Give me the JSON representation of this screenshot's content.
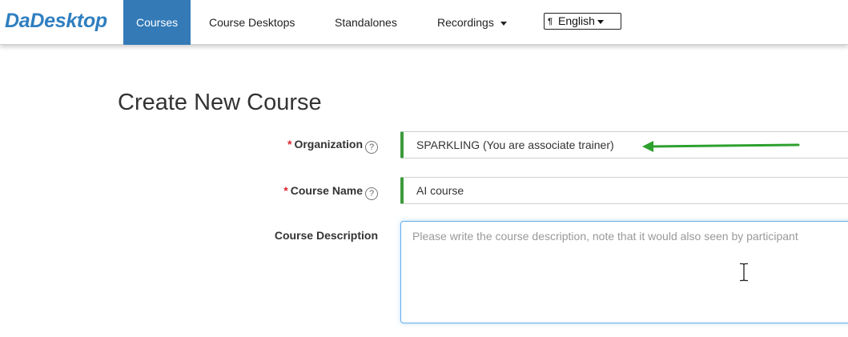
{
  "app": {
    "brand": "DaDesktop"
  },
  "nav": {
    "items": [
      {
        "label": "Courses",
        "active": true
      },
      {
        "label": "Course Desktops"
      },
      {
        "label": "Standalones"
      },
      {
        "label": "Recordings",
        "dropdown": true
      }
    ],
    "language": {
      "label": "English",
      "icon": "language-flag-icon"
    }
  },
  "page": {
    "title": "Create New Course"
  },
  "form": {
    "organization": {
      "label": "Organization",
      "required": true,
      "value": "SPARKLING (You are associate trainer)"
    },
    "course_name": {
      "label": "Course Name",
      "required": true,
      "value": "AI course"
    },
    "course_description": {
      "label": "Course Description",
      "value": "",
      "placeholder": "Please write the course description, note that it would also seen by participant"
    },
    "help_glyph": "?",
    "required_marker": "*"
  },
  "colors": {
    "brand": "#2f7fc0",
    "active_nav": "#337ab7",
    "valid_border": "#3c9a3c",
    "required": "#d9262f",
    "arrow": "#2ea02e"
  }
}
